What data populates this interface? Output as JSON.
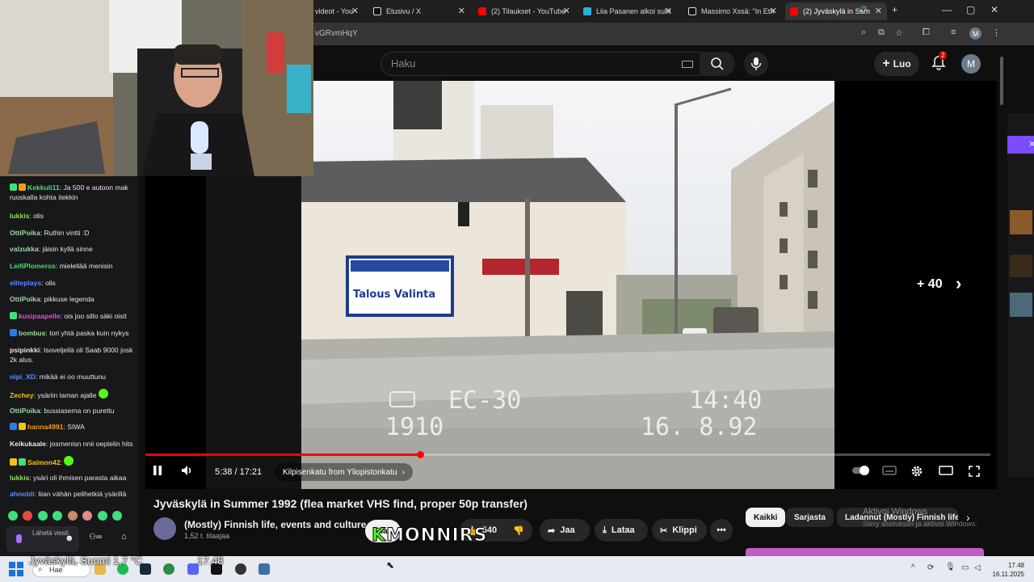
{
  "browser": {
    "tabs": [
      {
        "label": "videot - You",
        "icon_color": "#ff0000"
      },
      {
        "label": "Etusivu / X",
        "icon_color": "#ffffff"
      },
      {
        "label": "(2) Tilaukset - YouTube",
        "icon_color": "#ff0000"
      },
      {
        "label": "Liia Pasanen alkoi suht",
        "icon_color": "#1fb5d6"
      },
      {
        "label": "Massimo Xssä: \"In Eth",
        "icon_color": "#ffffff"
      },
      {
        "label": "(2) Jyväskylä in Sum",
        "icon_color": "#ff0000"
      }
    ],
    "url_fragment": "vGRvmHqY",
    "profile_initial": "M"
  },
  "youtube": {
    "search_placeholder": "Haku",
    "create_label": "Luo",
    "notification_count": "2",
    "avatar_initial": "M"
  },
  "player": {
    "osd_line1_left": "EC-30",
    "osd_line1_right": "14:40",
    "osd_line2_left": "1910",
    "osd_line2_right": "16.  8.92",
    "skip_label": "+ 40",
    "time_current": "5:38",
    "time_total": "17:21",
    "time_display": "5:38 / 17:21",
    "chapter": "Kilpisenkatu from Yliopistonkatu",
    "progress_fraction": 0.325,
    "accent": "#ff0000"
  },
  "video": {
    "title": "Jyväskylä in Summer 1992 (flea market VHS find, proper 50p transfer)",
    "channel_name": "(Mostly) Finnish life, events and culture",
    "subscribers": "1,52 t. tilaajaa",
    "subscribe_label": "Tilaa",
    "like_count": "540",
    "share_label": "Jaa",
    "download_label": "Lataa",
    "clip_label": "Klippi"
  },
  "chips": [
    "Kaikki",
    "Sarjasta",
    "Ladannut (Mostly) Finnish life"
  ],
  "windows_watermark": {
    "line1": "Aktivoi Windows",
    "line2": "Siirry asetuksiin ja aktivoi Windows."
  },
  "stream": {
    "logo_prefix": "K",
    "logo_text": "MONNIRS",
    "chat_input_label": "Lähetä viesti",
    "messages": [
      {
        "user": "Kekkuli11",
        "color": "#3ee07a",
        "text": "Ja 500 e autoon mak ruoskalla kohta itekkin"
      },
      {
        "user": "lukkis",
        "color": "#8ee04b",
        "text": "olis"
      },
      {
        "user": "OttiPoika",
        "color": "#9ad9a0",
        "text": "Ruthin vintti :D"
      },
      {
        "user": "valzukka",
        "color": "#9ad9a0",
        "text": "jäisin kyllä sinne"
      },
      {
        "user": "LeifiPlomeros",
        "color": "#48e06a",
        "text": "mielellää menisin"
      },
      {
        "user": "eliteplays",
        "color": "#5b8cff",
        "text": "olis"
      },
      {
        "user": "OttiPoika",
        "color": "#9ad9a0",
        "text": "pikkuse legenda"
      },
      {
        "user": "kusipaapelle",
        "color": "#e14fd6",
        "text": "ois joo sillo säki oisit"
      },
      {
        "user": "bombus",
        "color": "#9ad9a0",
        "text": "tori yhtä paska kuin nykys"
      },
      {
        "user": "psipinkki",
        "color": "#e6e6e6",
        "text": "Isoveljellä oli Saab 9000 josk 2k alus."
      },
      {
        "user": "nipi_XD",
        "color": "#5b8cff",
        "text": "mikää ei oo muuttunu"
      },
      {
        "user": "Zechey",
        "color": "#f1c40f",
        "text": "ysäriin laman ajalle"
      },
      {
        "user": "OttiPoika",
        "color": "#9ad9a0",
        "text": "bussiasema on purettu"
      },
      {
        "user": "hanna4991",
        "color": "#f39c12",
        "text": "SIWA"
      },
      {
        "user": "Keikukaale",
        "color": "#e6e6e6",
        "text": "josmenisn nnii oeptelin hits"
      },
      {
        "user": "Saimon42",
        "color": "#f1c40f",
        "text": ""
      },
      {
        "user": "lukkis",
        "color": "#8ee04b",
        "text": "ysäri oli ihmisen parasta aikaa"
      },
      {
        "user": "ahnoldi",
        "color": "#5b8cff",
        "text": "liian vähän pelihetkiä ysärillä"
      }
    ]
  },
  "taskbar": {
    "weather": "Jyväskylä, Suomi   1,7 °C",
    "overlay_time": "17.48",
    "search_label": "Hae",
    "clock_time": "17.48",
    "clock_date": "16.11.2025"
  }
}
